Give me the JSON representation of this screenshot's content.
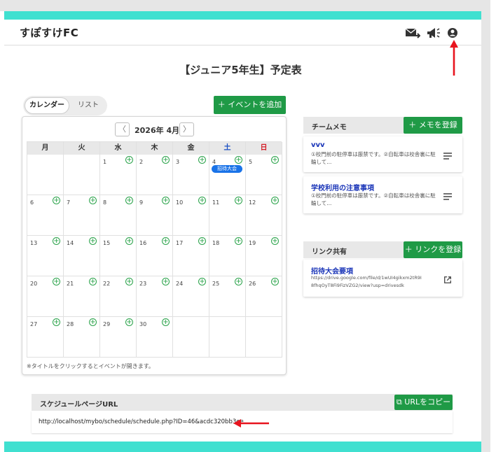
{
  "app": {
    "brand": "すぽすけFC"
  },
  "header": {
    "icons": [
      "mail-send-icon",
      "megaphone-icon",
      "account-icon"
    ]
  },
  "page": {
    "title": "【ジュニア5年生】予定表"
  },
  "view_toggle": {
    "active": "カレンダー",
    "other": "リスト"
  },
  "calendar": {
    "add_event_label": "＋ イベントを追加",
    "month_label": "2026年 4月",
    "prev_glyph": "〈",
    "next_glyph": "〉",
    "weekdays": [
      "月",
      "火",
      "水",
      "木",
      "金",
      "土",
      "日"
    ],
    "weeks": [
      [
        "",
        "",
        "1",
        "2",
        "3",
        "4",
        "5"
      ],
      [
        "6",
        "7",
        "8",
        "9",
        "10",
        "11",
        "12"
      ],
      [
        "13",
        "14",
        "15",
        "16",
        "17",
        "18",
        "19"
      ],
      [
        "20",
        "21",
        "22",
        "23",
        "24",
        "25",
        "26"
      ],
      [
        "27",
        "28",
        "29",
        "30",
        "",
        "",
        ""
      ]
    ],
    "events": [
      {
        "day": "4",
        "title": "招待大会"
      }
    ],
    "note": "※タイトルをクリックするとイベントが開きます。",
    "add_day_glyph": "+"
  },
  "team_memo": {
    "title": "チームメモ",
    "add_label": "＋ メモを登録",
    "items": [
      {
        "title": "vvv",
        "text": "①校門前の駐停車は厳禁です。②自転車は校舎裏に駐輪して..."
      },
      {
        "title": "学校利用の注意事項",
        "text": "①校門前の駐停車は厳禁です。②自転車は校舎裏に駐輪して..."
      }
    ]
  },
  "link_share": {
    "title": "リンク共有",
    "add_label": "＋ リンクを登録",
    "items": [
      {
        "title": "招待大会要項",
        "url": "https://drive.google.com/file/d/1wUI4gikxm2tR9I8fhqOyT8Fi9FizVZG2/view?usp=drivesdk"
      }
    ]
  },
  "schedule_url": {
    "title": "スケジュールページURL",
    "copy_label": "URLをコピー",
    "url": "http://localhost/mybo/schedule/schedule.php?ID=46&acdc320bb3ee"
  },
  "colors": {
    "accent_teal": "#40e0d0",
    "button_green": "#1f9a46",
    "event_blue": "#1a73e8",
    "annotation_red": "#e8141e"
  }
}
